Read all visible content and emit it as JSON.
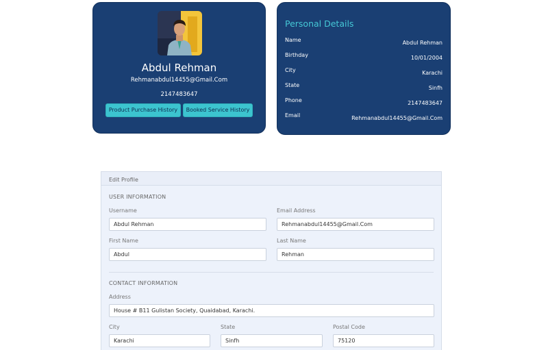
{
  "profile": {
    "name": "Abdul Rehman",
    "email": "Rehmanabdul14455@Gmail.Com",
    "phone": "2147483647",
    "buttons": {
      "purchase_history": "Product Purchase History",
      "service_history": "Booked Service History"
    }
  },
  "personal_details": {
    "title": "Personal Details",
    "rows": [
      {
        "label": "Name",
        "value": "Abdul Rehman"
      },
      {
        "label": "Birthday",
        "value": "10/01/2004"
      },
      {
        "label": "City",
        "value": "Karachi"
      },
      {
        "label": "State",
        "value": "Sinfh"
      },
      {
        "label": "Phone",
        "value": "2147483647"
      },
      {
        "label": "Email",
        "value": "Rehmanabdul14455@Gmail.Com"
      }
    ]
  },
  "edit_profile": {
    "header": "Edit Profile",
    "user_section": "USER INFORMATION",
    "contact_section": "CONTACT INFORMATION",
    "fields": {
      "username": {
        "label": "Username",
        "value": "Abdul Rehman"
      },
      "email": {
        "label": "Email Address",
        "value": "Rehmanabdul14455@Gmail.Com"
      },
      "first_name": {
        "label": "First Name",
        "value": "Abdul"
      },
      "last_name": {
        "label": "Last Name",
        "value": "Rehman"
      },
      "address": {
        "label": "Address",
        "value": "House # B11 Gulistan Society, Quaidabad, Karachi."
      },
      "city": {
        "label": "City",
        "value": "Karachi"
      },
      "state": {
        "label": "State",
        "value": "Sinfh"
      },
      "postal_code": {
        "label": "Postal Code",
        "value": "75120"
      }
    }
  },
  "colors": {
    "card_bg": "#1a3f73",
    "accent": "#45c8d6",
    "button_bg": "#3cc4cf",
    "panel_bg": "#edf2fb"
  }
}
